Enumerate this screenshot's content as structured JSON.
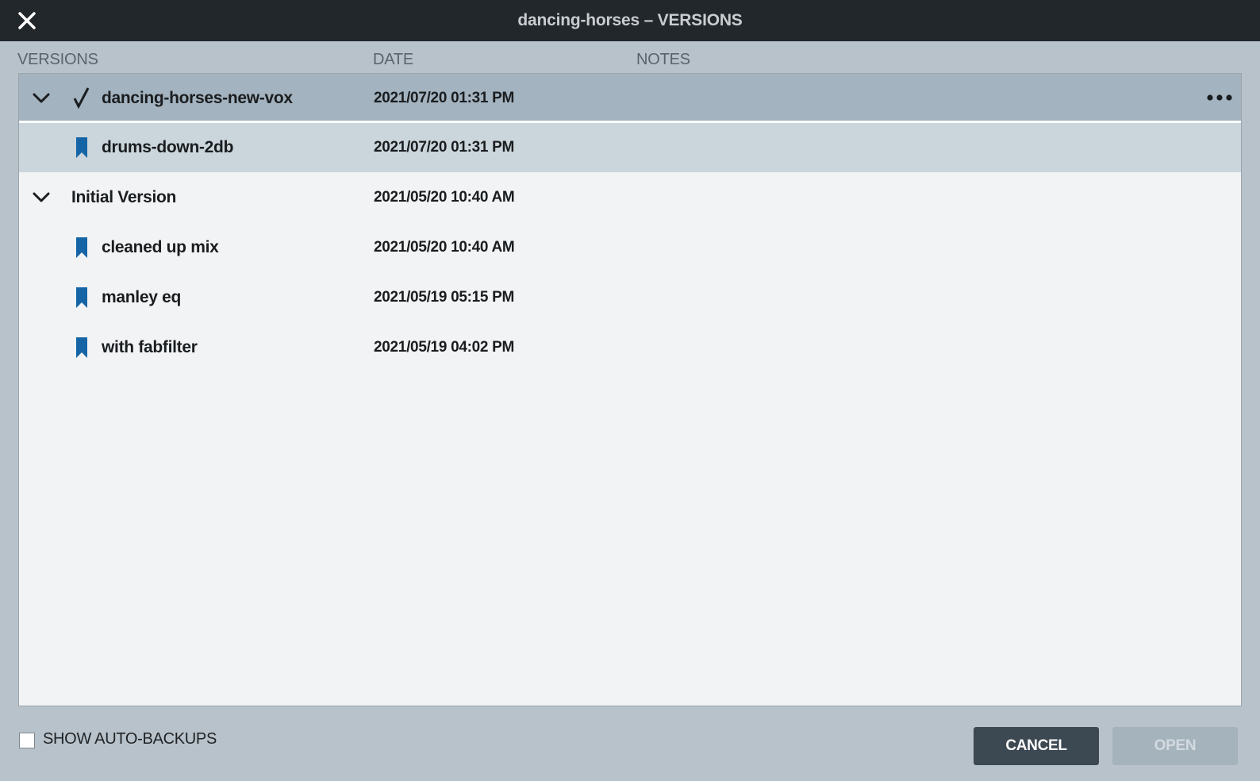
{
  "window": {
    "title": "dancing-horses – VERSIONS"
  },
  "columns": {
    "versions": "VERSIONS",
    "date": "DATE",
    "notes": "NOTES"
  },
  "rows": [
    {
      "name": "dancing-horses-new-vox",
      "date": "2021/07/20 01:31 PM",
      "type": "version",
      "current": true,
      "selected": true,
      "expanded": true
    },
    {
      "name": "drums-down-2db",
      "date": "2021/07/20 01:31 PM",
      "type": "snapshot",
      "highlighted": true
    },
    {
      "name": "Initial Version",
      "date": "2021/05/20 10:40 AM",
      "type": "version",
      "expanded": true
    },
    {
      "name": "cleaned up mix",
      "date": "2021/05/20 10:40 AM",
      "type": "snapshot"
    },
    {
      "name": "manley eq",
      "date": "2021/05/19 05:15 PM",
      "type": "snapshot"
    },
    {
      "name": "with fabfilter",
      "date": "2021/05/19 04:02 PM",
      "type": "snapshot"
    }
  ],
  "footer": {
    "show_auto_backups_label": "SHOW AUTO-BACKUPS",
    "show_auto_backups_checked": false,
    "cancel_label": "CANCEL",
    "open_label": "OPEN"
  },
  "colors": {
    "titlebar": "#22272b",
    "selected_row": "#a3b3bf",
    "highlight_row": "#cbd5dc",
    "bookmark": "#1565a6",
    "cancel_button": "#3c4852",
    "open_button_disabled": "#a5b3bd"
  },
  "icons": {
    "close": "close-icon",
    "expand": "chevron-down-icon",
    "current": "checkmark-icon",
    "snapshot": "bookmark-icon",
    "more": "more-options-icon"
  }
}
